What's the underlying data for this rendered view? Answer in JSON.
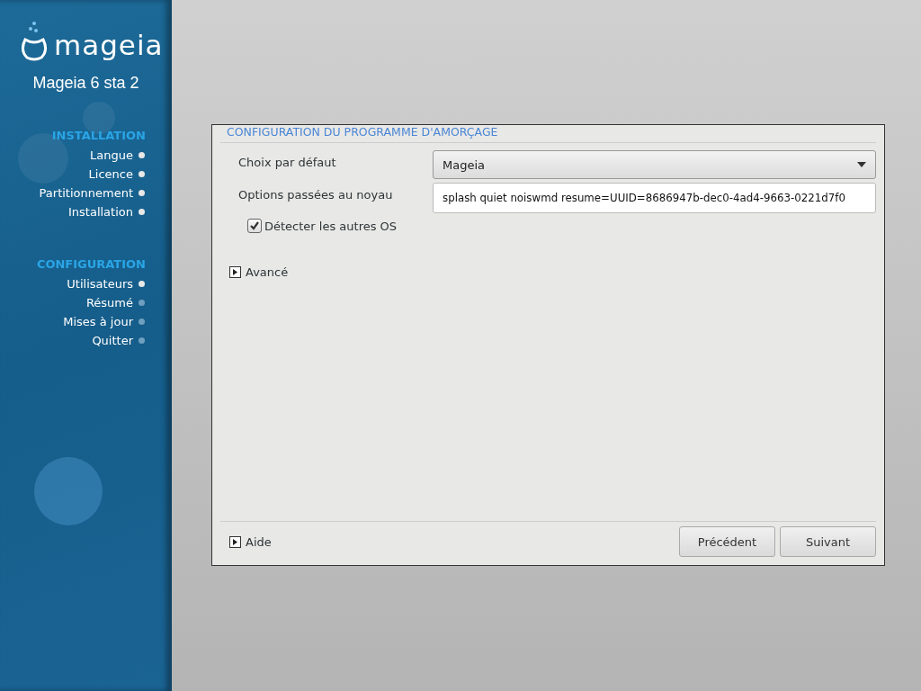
{
  "sidebar": {
    "logo": "mageia",
    "version": "Mageia 6 sta 2",
    "sections": [
      {
        "title": "INSTALLATION",
        "steps": [
          {
            "label": "Langue",
            "done": true
          },
          {
            "label": "Licence",
            "done": true
          },
          {
            "label": "Partitionnement",
            "done": true
          },
          {
            "label": "Installation",
            "done": true
          }
        ]
      },
      {
        "title": "CONFIGURATION",
        "steps": [
          {
            "label": "Utilisateurs",
            "done": true
          },
          {
            "label": "Résumé",
            "done": false
          },
          {
            "label": "Mises à jour",
            "done": false
          },
          {
            "label": "Quitter",
            "done": false
          }
        ]
      }
    ]
  },
  "dialog": {
    "title": "CONFIGURATION DU PROGRAMME D'AMORÇAGE",
    "default_choice": {
      "label": "Choix par défaut",
      "value": "Mageia"
    },
    "kernel_options": {
      "label": "Options passées au noyau",
      "value": "splash quiet noiswmd resume=UUID=8686947b-dec0-4ad4-9663-0221d7f0"
    },
    "detect_os": {
      "label": "Détecter les autres OS",
      "checked": true
    },
    "advanced": {
      "label": "Avancé",
      "expanded": false
    },
    "help": {
      "label": "Aide",
      "expanded": false
    },
    "buttons": [
      "Précédent",
      "Suivant"
    ]
  }
}
